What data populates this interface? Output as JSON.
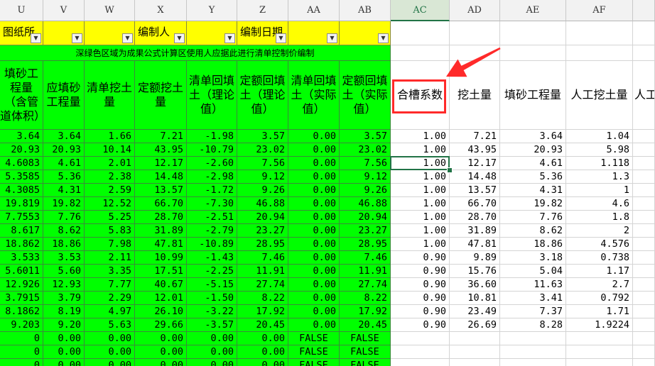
{
  "columns": [
    "U",
    "V",
    "W",
    "X",
    "Y",
    "Z",
    "AA",
    "AB",
    "AC",
    "AD",
    "AE",
    "AF",
    ""
  ],
  "selected_column": "AC",
  "row2": [
    {
      "text": "图纸所",
      "dropdown": true
    },
    {
      "text": "",
      "dropdown": true
    },
    {
      "text": "",
      "dropdown": true
    },
    {
      "text": "编制人",
      "dropdown": true
    },
    {
      "text": "",
      "dropdown": true
    },
    {
      "text": "编制日期",
      "dropdown": true
    },
    {
      "text": "",
      "dropdown": true
    },
    {
      "text": "",
      "dropdown": true
    }
  ],
  "banner": "深绿色区域为成果公式计算区使用人应据此进行清单控制价编制",
  "headers": [
    "填砂工程量（含管道体积）",
    "应填砂工程量",
    "清单挖土量",
    "定额挖土量",
    "清单回填土（理论值）",
    "定额回填土（理论值）",
    "清单回填土（实际值）",
    "定额回填土（实际值）",
    "合槽系数",
    "挖土量",
    "填砂工程量",
    "人工挖土量",
    "人工"
  ],
  "rows": [
    [
      "3.64",
      "3.64",
      "1.66",
      "7.21",
      "-1.98",
      "3.57",
      "0.00",
      "3.57",
      "1.00",
      "7.21",
      "3.64",
      "1.04"
    ],
    [
      "20.93",
      "20.93",
      "10.14",
      "43.95",
      "-10.79",
      "23.02",
      "0.00",
      "23.02",
      "1.00",
      "43.95",
      "20.93",
      "5.98"
    ],
    [
      "4.6083",
      "4.61",
      "2.01",
      "12.17",
      "-2.60",
      "7.56",
      "0.00",
      "7.56",
      "1.00",
      "12.17",
      "4.61",
      "1.118"
    ],
    [
      "5.3585",
      "5.36",
      "2.38",
      "14.48",
      "-2.98",
      "9.12",
      "0.00",
      "9.12",
      "1.00",
      "14.48",
      "5.36",
      "1.3"
    ],
    [
      "4.3085",
      "4.31",
      "2.59",
      "13.57",
      "-1.72",
      "9.26",
      "0.00",
      "9.26",
      "1.00",
      "13.57",
      "4.31",
      "1"
    ],
    [
      "19.819",
      "19.82",
      "12.52",
      "66.70",
      "-7.30",
      "46.88",
      "0.00",
      "46.88",
      "1.00",
      "66.70",
      "19.82",
      "4.6"
    ],
    [
      "7.7553",
      "7.76",
      "5.25",
      "28.70",
      "-2.51",
      "20.94",
      "0.00",
      "20.94",
      "1.00",
      "28.70",
      "7.76",
      "1.8"
    ],
    [
      "8.617",
      "8.62",
      "5.83",
      "31.89",
      "-2.79",
      "23.27",
      "0.00",
      "23.27",
      "1.00",
      "31.89",
      "8.62",
      "2"
    ],
    [
      "18.862",
      "18.86",
      "7.98",
      "47.81",
      "-10.89",
      "28.95",
      "0.00",
      "28.95",
      "1.00",
      "47.81",
      "18.86",
      "4.576"
    ],
    [
      "3.533",
      "3.53",
      "2.11",
      "10.99",
      "-1.43",
      "7.46",
      "0.00",
      "7.46",
      "0.90",
      "9.89",
      "3.18",
      "0.738"
    ],
    [
      "5.6011",
      "5.60",
      "3.35",
      "17.51",
      "-2.25",
      "11.91",
      "0.00",
      "11.91",
      "0.90",
      "15.76",
      "5.04",
      "1.17"
    ],
    [
      "12.926",
      "12.93",
      "7.77",
      "40.67",
      "-5.15",
      "27.74",
      "0.00",
      "27.74",
      "0.90",
      "36.60",
      "11.63",
      "2.7"
    ],
    [
      "3.7915",
      "3.79",
      "2.29",
      "12.01",
      "-1.50",
      "8.22",
      "0.00",
      "8.22",
      "0.90",
      "10.81",
      "3.41",
      "0.792"
    ],
    [
      "8.1862",
      "8.19",
      "4.97",
      "26.10",
      "-3.22",
      "17.92",
      "0.00",
      "17.92",
      "0.90",
      "23.49",
      "7.37",
      "1.71"
    ],
    [
      "9.203",
      "9.20",
      "5.63",
      "29.66",
      "-3.57",
      "20.45",
      "0.00",
      "20.45",
      "0.90",
      "26.69",
      "8.28",
      "1.9224"
    ],
    [
      "0",
      "0.00",
      "0.00",
      "0.00",
      "0.00",
      "0.00",
      "FALSE",
      "FALSE",
      "",
      "",
      "",
      ""
    ],
    [
      "0",
      "0.00",
      "0.00",
      "0.00",
      "0.00",
      "0.00",
      "FALSE",
      "FALSE",
      "",
      "",
      "",
      ""
    ],
    [
      "0",
      "0.00",
      "0.00",
      "0.00",
      "0.00",
      "0.00",
      "FALSE",
      "FALSE",
      "",
      "",
      "",
      ""
    ]
  ],
  "selected_cell": {
    "row": 2,
    "col": 8
  },
  "highlighted_header_col": 8,
  "colors": {
    "green": "#00ff00",
    "yellow": "#ffff00",
    "selection": "#217346",
    "annotation": "#ff2a2a"
  },
  "icons": {
    "dropdown": "dropdown-arrow-icon",
    "arrow": "red-arrow-icon"
  }
}
